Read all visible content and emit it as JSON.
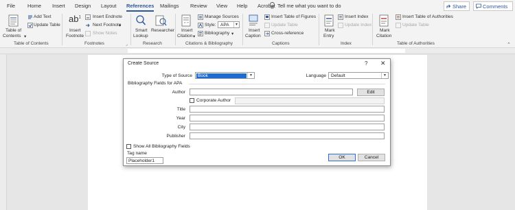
{
  "tabs": [
    "File",
    "Home",
    "Insert",
    "Design",
    "Layout",
    "References",
    "Mailings",
    "Review",
    "View",
    "Help",
    "Acrobat"
  ],
  "active_tab": "References",
  "tell_me": "Tell me what you want to do",
  "share_label": "Share",
  "comments_label": "Comments",
  "ribbon": {
    "toc": {
      "table_of_contents": "Table of",
      "table_of_contents_2": "Contents",
      "add_text": "Add Text",
      "update_table": "Update Table",
      "group": "Table of Contents"
    },
    "footnotes": {
      "insert_footnote": "Insert",
      "insert_footnote_2": "Footnote",
      "insert_endnote": "Insert Endnote",
      "next_footnote": "Next Footnote",
      "show_notes": "Show Notes",
      "group": "Footnotes"
    },
    "research": {
      "smart_lookup": "Smart",
      "smart_lookup_2": "Lookup",
      "researcher": "Researcher",
      "group": "Research"
    },
    "citations": {
      "insert_citation": "Insert",
      "insert_citation_2": "Citation",
      "manage_sources": "Manage Sources",
      "style_label": "Style:",
      "style_value": "APA",
      "bibliography": "Bibliography",
      "group": "Citations & Bibliography"
    },
    "captions": {
      "insert_caption": "Insert",
      "insert_caption_2": "Caption",
      "insert_table_of_figures": "Insert Table of Figures",
      "update_table": "Update Table",
      "cross_reference": "Cross-reference",
      "group": "Captions"
    },
    "index": {
      "mark_entry": "Mark",
      "mark_entry_2": "Entry",
      "insert_index": "Insert Index",
      "update_index": "Update Index",
      "group": "Index"
    },
    "authorities": {
      "mark_citation": "Mark",
      "mark_citation_2": "Citation",
      "insert_table_of_authorities": "Insert Table of Authorities",
      "update_table": "Update Table",
      "group": "Table of Authorities"
    }
  },
  "dialog": {
    "title": "Create Source",
    "help": "?",
    "close": "✕",
    "type_of_source_label": "Type of Source",
    "type_of_source_value": "Book",
    "language_label": "Language",
    "language_value": "Default",
    "fields_heading": "Bibliography Fields for APA",
    "author_label": "Author",
    "edit_button": "Edit",
    "corporate_author_label": "Corporate Author",
    "title_label": "Title",
    "year_label": "Year",
    "city_label": "City",
    "publisher_label": "Publisher",
    "show_all_label": "Show All Bibliography Fields",
    "tag_name_label": "Tag name",
    "tag_name_value": "Placeholder1",
    "ok_button": "OK",
    "cancel_button": "Cancel"
  },
  "colors": {
    "accent": "#2b579a",
    "selection": "#1c6bd2"
  }
}
